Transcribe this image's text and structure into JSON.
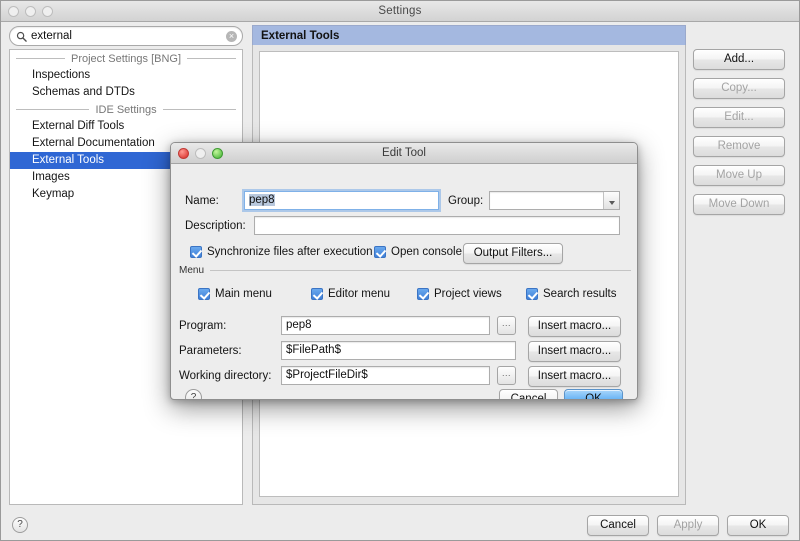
{
  "window": {
    "title": "Settings",
    "traffic_lights": [
      "close-off",
      "minimize-off",
      "zoom-off"
    ]
  },
  "search": {
    "value": "external",
    "placeholder": "",
    "icon": "search-icon",
    "clear_icon": "×"
  },
  "sidebar": {
    "groups": [
      {
        "label": "Project Settings [BNG]",
        "items": [
          {
            "label": "Inspections",
            "selected": false
          },
          {
            "label": "Schemas and DTDs",
            "selected": false
          }
        ]
      },
      {
        "label": "IDE Settings",
        "items": [
          {
            "label": "External Diff Tools",
            "selected": false
          },
          {
            "label": "External Documentation",
            "selected": false
          },
          {
            "label": "External Tools",
            "selected": true
          },
          {
            "label": "Images",
            "selected": false
          },
          {
            "label": "Keymap",
            "selected": false
          }
        ]
      }
    ],
    "selection_color": "#2f67d4"
  },
  "content": {
    "header_title": "External Tools",
    "header_color": "#a4b8e0",
    "list_items": []
  },
  "side_buttons": [
    {
      "label": "Add...",
      "enabled": true
    },
    {
      "label": "Copy...",
      "enabled": false
    },
    {
      "label": "Edit...",
      "enabled": false
    },
    {
      "label": "Remove",
      "enabled": false
    },
    {
      "label": "Move Up",
      "enabled": false
    },
    {
      "label": "Move Down",
      "enabled": false
    }
  ],
  "footer": {
    "help_label": "?",
    "cancel_label": "Cancel",
    "apply_label": "Apply",
    "apply_enabled": false,
    "ok_label": "OK"
  },
  "dialog": {
    "title": "Edit Tool",
    "traffic_lights": [
      "close-red",
      "minimize-off",
      "zoom-green"
    ],
    "name_label": "Name:",
    "name_value": "pep8",
    "group_label": "Group:",
    "group_value": "",
    "description_label": "Description:",
    "description_value": "",
    "sync_checkbox": {
      "label": "Synchronize files after execution",
      "checked": true
    },
    "console_checkbox": {
      "label": "Open console",
      "checked": true
    },
    "output_filters_label": "Output Filters...",
    "menu_group_label": "Menu",
    "menu_checkboxes": [
      {
        "label": "Main menu",
        "checked": true
      },
      {
        "label": "Editor menu",
        "checked": true
      },
      {
        "label": "Project views",
        "checked": true
      },
      {
        "label": "Search results",
        "checked": true
      }
    ],
    "program_label": "Program:",
    "program_value": "pep8",
    "parameters_label": "Parameters:",
    "parameters_value": "$FilePath$",
    "workdir_label": "Working directory:",
    "workdir_value": "$ProjectFileDir$",
    "browse_label": "...",
    "insert_macro_label": "Insert macro...",
    "help_label": "?",
    "cancel_label": "Cancel",
    "ok_label": "OK",
    "focus_ring_color": "#7fb1e8"
  }
}
